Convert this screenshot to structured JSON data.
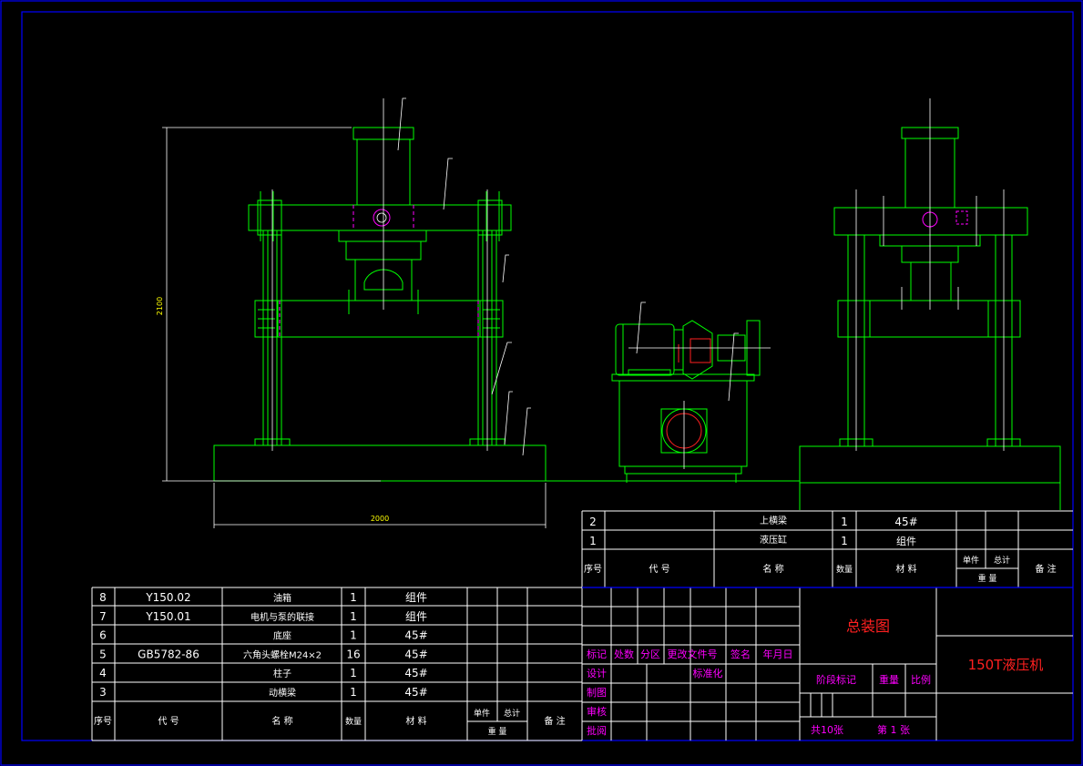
{
  "colors": {
    "background": "#000000",
    "frame": "#0000ff",
    "outline": "#00ff00",
    "centerline": "#ffffff",
    "hidden": "#ff00ff",
    "dimension": "#ffff00",
    "title_text": "#ff2020",
    "table_line": "#ffffff"
  },
  "dimensions": {
    "height": "2100",
    "width": "2000"
  },
  "upper_parts": {
    "headers": {
      "seq": "序号",
      "code": "代  号",
      "name": "名    称",
      "qty": "数量",
      "material": "材    料",
      "unit_weight": "单件",
      "total_weight": "总计",
      "weight": "重  量",
      "remark": "备 注"
    },
    "rows": [
      {
        "seq": "2",
        "code": "",
        "name": "上横梁",
        "qty": "1",
        "material": "45#",
        "remark": ""
      },
      {
        "seq": "1",
        "code": "",
        "name": "液压缸",
        "qty": "1",
        "material": "组件",
        "remark": ""
      }
    ]
  },
  "lower_parts": {
    "headers": {
      "seq": "序号",
      "code": "代    号",
      "name": "名    称",
      "qty": "数量",
      "material": "材    料",
      "unit_weight": "单件",
      "total_weight": "总计",
      "weight": "重  量",
      "remark": "备 注"
    },
    "rows": [
      {
        "seq": "8",
        "code": "Y150.02",
        "name": "油箱",
        "qty": "1",
        "material": "组件"
      },
      {
        "seq": "7",
        "code": "Y150.01",
        "name": "电机与泵的联接",
        "qty": "1",
        "material": "组件"
      },
      {
        "seq": "6",
        "code": "",
        "name": "底座",
        "qty": "1",
        "material": "45#"
      },
      {
        "seq": "5",
        "code": "GB5782-86",
        "name": "六角头螺栓M24×2",
        "qty": "16",
        "material": "45#"
      },
      {
        "seq": "4",
        "code": "",
        "name": "柱子",
        "qty": "1",
        "material": "45#"
      },
      {
        "seq": "3",
        "code": "",
        "name": "动横梁",
        "qty": "1",
        "material": "45#"
      }
    ]
  },
  "title_block": {
    "revision_labels": [
      "标记",
      "处数",
      "分区",
      "更改文件号",
      "签名",
      "年月日"
    ],
    "signoff_labels": [
      "设计",
      "制图",
      "审核",
      "批阅"
    ],
    "standardize": "标准化",
    "drawing_title": "总装图",
    "stage_mark": "阶段标记",
    "weight": "重量",
    "scale": "比例",
    "sheets_total": "共10张",
    "sheet_no": "第 1 张",
    "product_name": "150T液压机"
  }
}
